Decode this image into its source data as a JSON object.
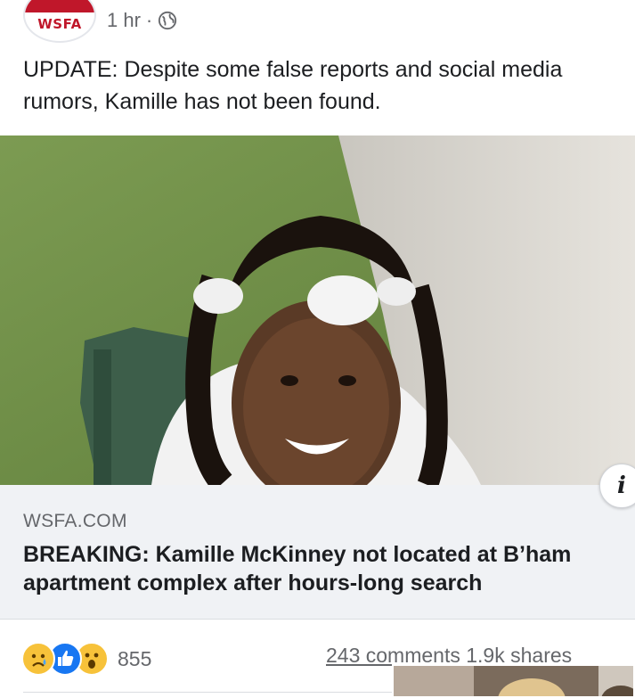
{
  "header": {
    "page_logo_text": "WSFA",
    "timestamp": "1 hr",
    "separator": "·",
    "audience_icon": "globe-icon"
  },
  "post": {
    "text_line1": "UPDATE: Despite some false reports and social media",
    "text_line2": "rumors, Kamille has not been found."
  },
  "link_preview": {
    "domain": "WSFA.COM",
    "headline_line1": "BREAKING: Kamille McKinney not located at B’ham",
    "headline_line2": "apartment complex after hours-long search",
    "info_icon": "info-icon"
  },
  "engagement": {
    "reaction_icons": [
      "sad-icon",
      "like-icon",
      "wow-icon"
    ],
    "reaction_count": "855",
    "comments": "243 comments",
    "shares": "1.9k shares"
  },
  "colors": {
    "brand_red": "#c0172a",
    "like_blue": "#1877f2",
    "reaction_yellow": "#f7c23a",
    "link_bg": "#f0f2f5",
    "meta_gray": "#65676b"
  }
}
